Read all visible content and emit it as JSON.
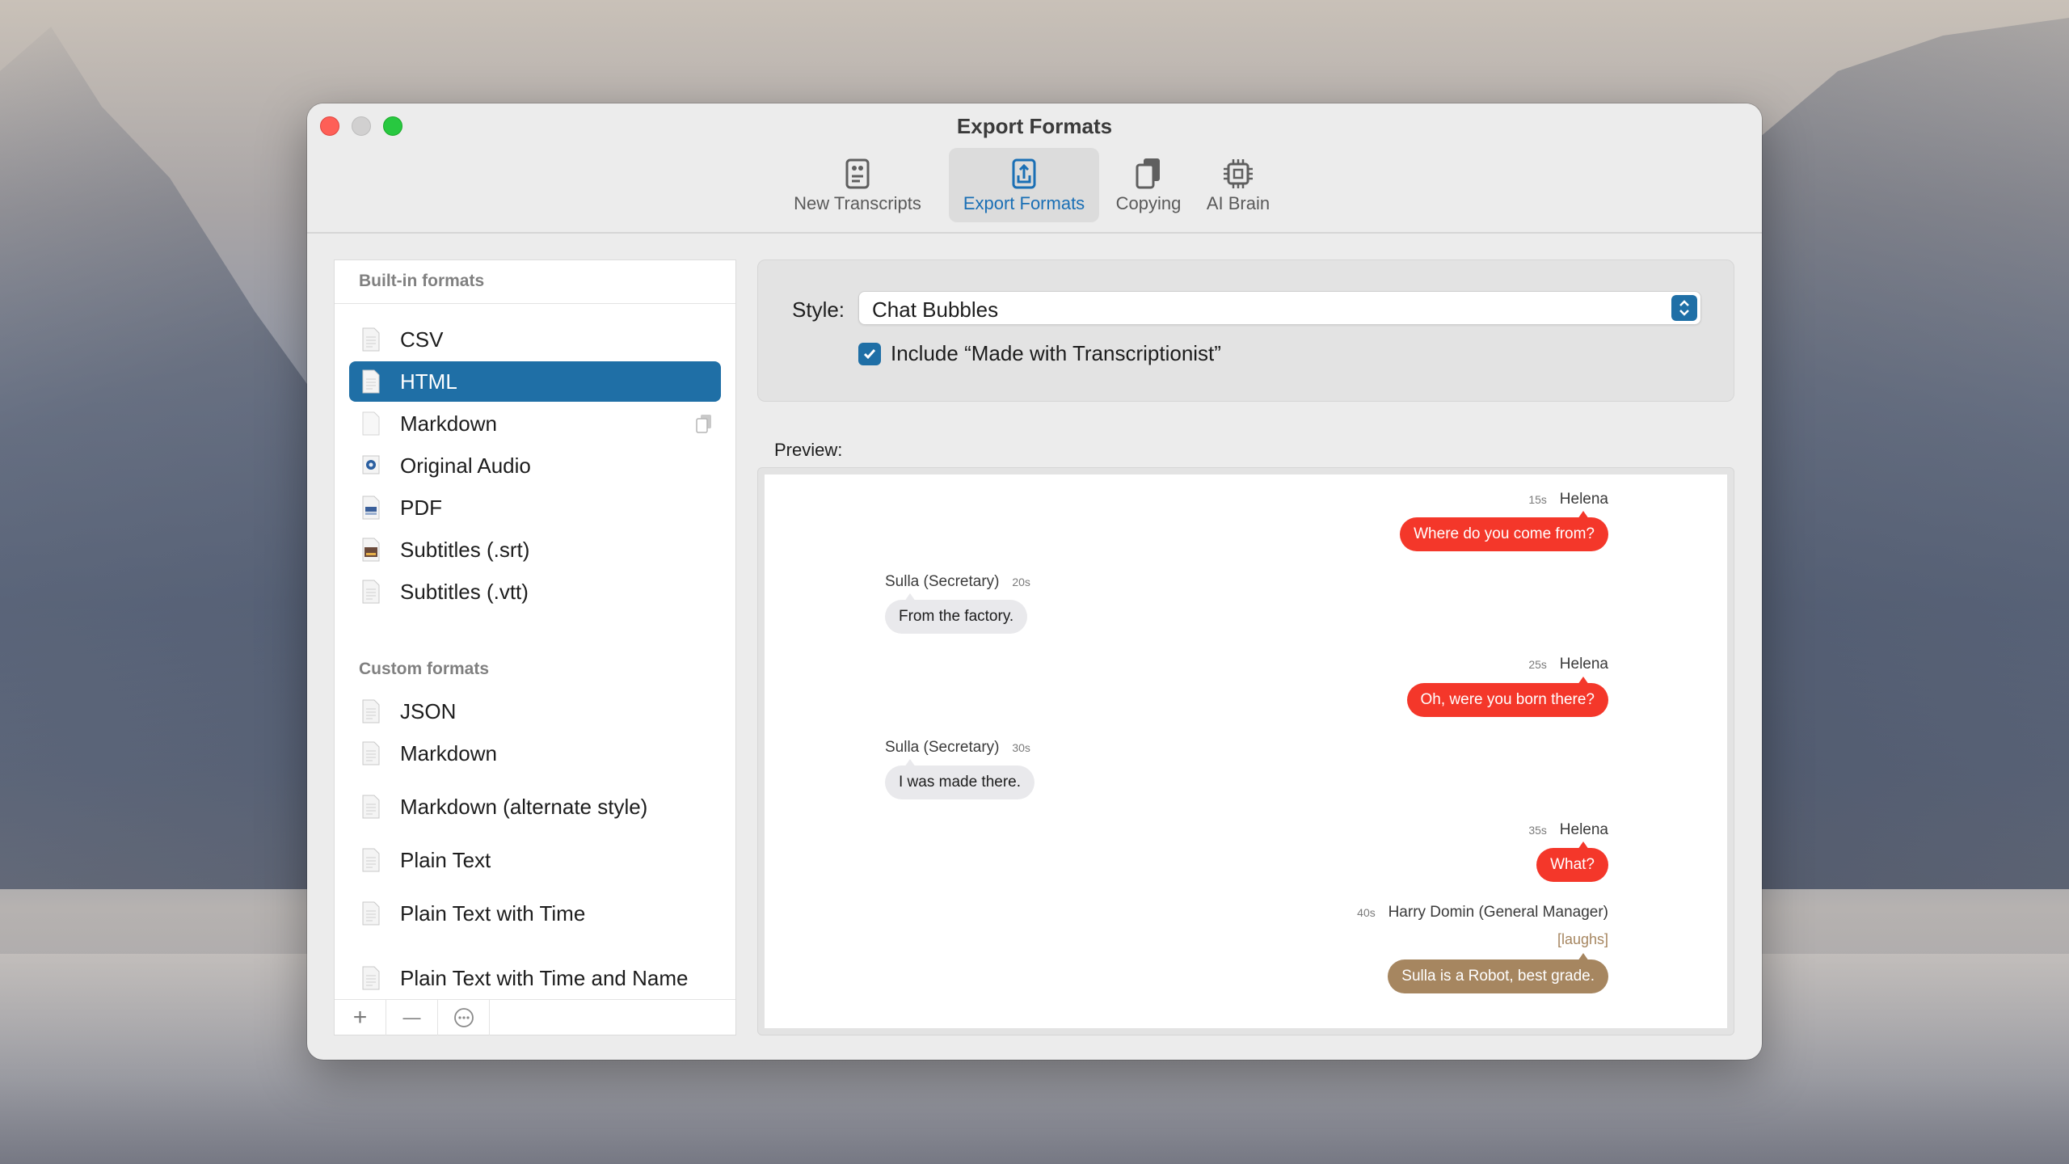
{
  "window": {
    "title": "Export Formats"
  },
  "toolbar": {
    "items": [
      {
        "label": "New Transcripts",
        "icon": "new-transcripts-icon"
      },
      {
        "label": "Export Formats",
        "icon": "export-formats-icon",
        "active": true
      },
      {
        "label": "Copying",
        "icon": "copying-icon"
      },
      {
        "label": "AI Brain",
        "icon": "ai-brain-icon"
      }
    ]
  },
  "sidebar": {
    "builtin_title": "Built-in formats",
    "builtin": [
      {
        "label": "CSV",
        "icon": "document-icon"
      },
      {
        "label": "HTML",
        "icon": "document-icon",
        "selected": true
      },
      {
        "label": "Markdown",
        "icon": "document-icon",
        "badge": "duplicate-icon"
      },
      {
        "label": "Original Audio",
        "icon": "audio-file-icon"
      },
      {
        "label": "PDF",
        "icon": "pdf-file-icon"
      },
      {
        "label": "Subtitles (.srt)",
        "icon": "subtitle-file-icon"
      },
      {
        "label": "Subtitles (.vtt)",
        "icon": "document-icon"
      }
    ],
    "custom_title": "Custom formats",
    "custom": [
      {
        "label": "JSON",
        "icon": "document-icon"
      },
      {
        "label": "Markdown",
        "icon": "document-icon"
      },
      {
        "label": "Markdown (alternate style)",
        "icon": "document-icon"
      },
      {
        "label": "Plain Text",
        "icon": "document-icon"
      },
      {
        "label": "Plain Text with Time",
        "icon": "document-icon"
      },
      {
        "label": "Plain Text with Time and Name",
        "icon": "document-icon"
      }
    ],
    "buttons": {
      "add": "+",
      "remove": "—",
      "more": "···"
    }
  },
  "style": {
    "label": "Style:",
    "value": "Chat Bubbles",
    "include_label": "Include “Made with Transcriptionist”",
    "include_checked": true
  },
  "preview": {
    "label": "Preview:",
    "messages": [
      {
        "speaker": "Helena",
        "time": "15s",
        "text": "Where do you come from?",
        "side": "right",
        "color": "#f4372a"
      },
      {
        "speaker": "Sulla (Secretary)",
        "time": "20s",
        "text": "From the factory.",
        "side": "left",
        "color": "#e9e9ec"
      },
      {
        "speaker": "Helena",
        "time": "25s",
        "text": "Oh, were you born there?",
        "side": "right",
        "color": "#f4372a"
      },
      {
        "speaker": "Sulla (Secretary)",
        "time": "30s",
        "text": "I was made there.",
        "side": "left",
        "color": "#e9e9ec"
      },
      {
        "speaker": "Helena",
        "time": "35s",
        "text": "What?",
        "side": "right",
        "color": "#f4372a"
      },
      {
        "speaker": "Harry Domin (General Manager)",
        "time": "40s",
        "annotation": "[laughs]",
        "text": "Sulla is a Robot, best grade.",
        "side": "right",
        "color": "#a68660"
      }
    ]
  },
  "colors": {
    "accent": "#1f6fa6",
    "close": "#fe5f57",
    "maximize": "#28c840"
  }
}
